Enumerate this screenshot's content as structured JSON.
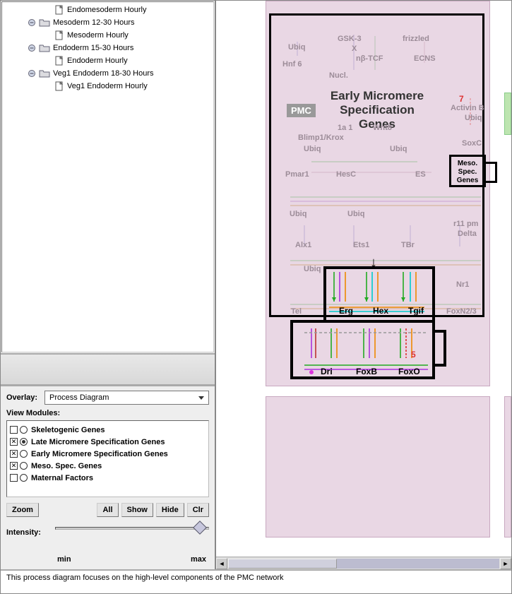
{
  "tree": {
    "n0": "Endomesoderm Hourly",
    "n1": "Mesoderm 12-30 Hours",
    "n1a": "Mesoderm Hourly",
    "n2": "Endoderm 15-30 Hours",
    "n2a": "Endoderm Hourly",
    "n3": "Veg1 Endoderm 18-30 Hours",
    "n3a": "Veg1 Endoderm Hourly"
  },
  "overlay": {
    "label": "Overlay:",
    "value": "Process Diagram"
  },
  "view_modules_label": "View Modules:",
  "modules": [
    {
      "checked": false,
      "selected": false,
      "label": "Skeletogenic Genes"
    },
    {
      "checked": true,
      "selected": true,
      "label": "Late Micromere Specification Genes"
    },
    {
      "checked": true,
      "selected": false,
      "label": "Early Micromere Specification Genes"
    },
    {
      "checked": true,
      "selected": false,
      "label": "Meso. Spec. Genes"
    },
    {
      "checked": false,
      "selected": false,
      "label": "Maternal Factors"
    }
  ],
  "buttons": {
    "zoom": "Zoom",
    "all": "All",
    "show": "Show",
    "hide": "Hide",
    "clr": "Clr"
  },
  "intensity": {
    "label": "Intensity:",
    "min": "min",
    "max": "max"
  },
  "diagram": {
    "title_l1": "Early Micromere",
    "title_l2": "Specification",
    "title_l3": "Genes",
    "pmc": "PMC",
    "meso_l1": "Meso.",
    "meso_l2": "Spec.",
    "meso_l3": "Genes",
    "red5": "5",
    "red7": "7",
    "focus": {
      "erg": "Erg",
      "hex": "Hex",
      "tgif": "Tgif",
      "dri": "Dri",
      "foxb": "FoxB",
      "foxo": "FoxO"
    },
    "faded": {
      "ubiq1": "Ubiq",
      "gsk3": "GSK-3",
      "x": "X",
      "frizzled": "frizzled",
      "hnf6": "Hnf 6",
      "nbt": "nβ-TCF",
      "ecns": "ECNS",
      "nucl": "Nucl.",
      "oneA": "1a 1",
      "wnt8": "Wnt8",
      "blimp": "Blimp1/Krox",
      "activinb": "Activin B",
      "ubiq2": "Ubiq",
      "ubiq3": "Ubiq",
      "ubiq4": "Ubiq",
      "soxc": "SoxC",
      "pmar1": "Pmar1",
      "hesc": "HesC",
      "es": "ES",
      "ubiq5": "Ubiq",
      "ubiq6": "Ubiq",
      "r11pm": "r11 pm",
      "delta": "Delta",
      "alx1": "Alx1",
      "ets1": "Ets1",
      "tbr": "TBr",
      "ubiq7": "Ubiq",
      "nr1": "Nr1",
      "tel": "Tel",
      "foxn23": "FoxN2/3"
    }
  },
  "status": "This process diagram focuses on the high-level components of the PMC network"
}
